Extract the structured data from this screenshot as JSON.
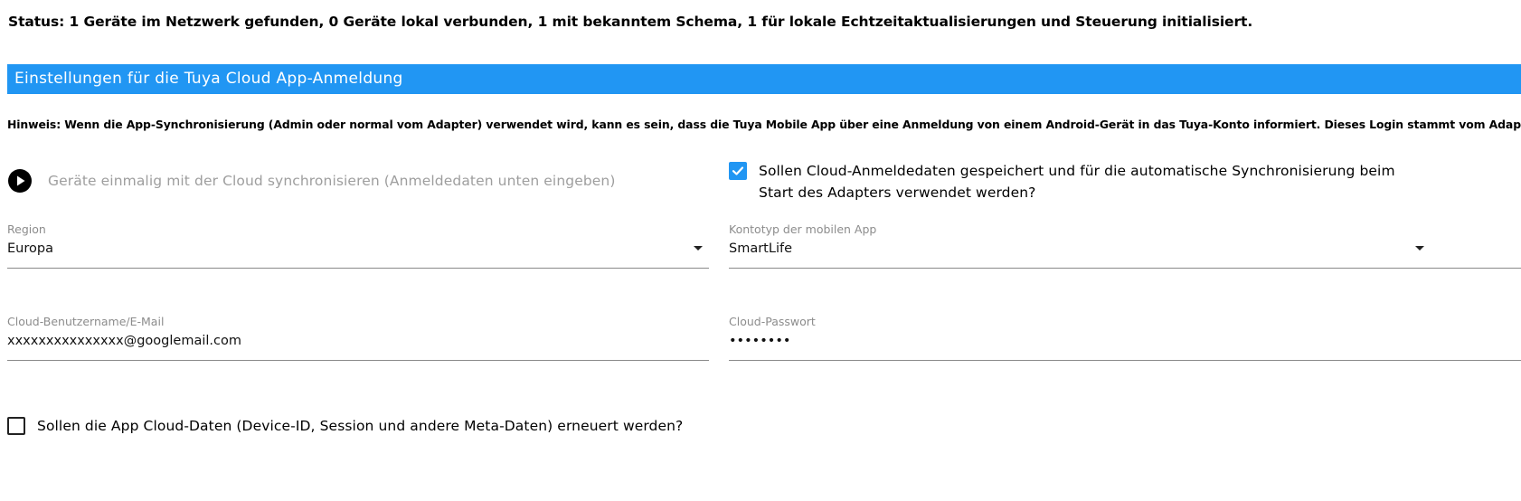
{
  "status_text": "Status: 1 Geräte im Netzwerk gefunden, 0 Geräte lokal verbunden, 1 mit bekanntem Schema, 1 für lokale Echtzeitaktualisierungen und Steuerung initialisiert.",
  "section": {
    "title": "Einstellungen für die Tuya Cloud App-Anmeldung",
    "color": "#2196f3"
  },
  "hint": "Hinweis: Wenn die App-Synchronisierung (Admin oder normal vom Adapter) verwendet wird, kann es sein, dass die Tuya Mobile App über eine Anmeldung von einem Android-Gerät in das Tuya-Konto informiert. Dieses Login stammt vom Adapter!",
  "sync_button": {
    "icon": "play-circle-icon",
    "label": "Geräte einmalig mit der Cloud synchronisieren (Anmeldedaten unten eingeben)"
  },
  "save_credentials": {
    "checked": true,
    "label": "Sollen Cloud-Anmeldedaten gespeichert und für die automatische Synchronisierung beim Start des Adapters verwendet werden?"
  },
  "region": {
    "label": "Region",
    "value": "Europa"
  },
  "app_type": {
    "label": "Kontotyp der mobilen App",
    "value": "SmartLife"
  },
  "username": {
    "label": "Cloud-Benutzername/E-Mail",
    "value": "xxxxxxxxxxxxxxx@googlemail.com"
  },
  "password": {
    "label": "Cloud-Passwort",
    "value": "••••••••"
  },
  "renew_cloud_data": {
    "checked": false,
    "label": "Sollen die App Cloud-Daten (Device-ID, Session und andere Meta-Daten) erneuert werden?"
  }
}
